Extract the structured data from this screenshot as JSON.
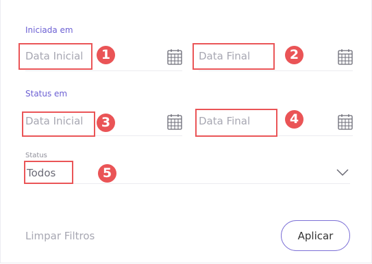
{
  "sections": {
    "started": {
      "label": "Iniciada em",
      "start_placeholder": "Data Inicial",
      "end_placeholder": "Data Final"
    },
    "status_date": {
      "label": "Status em",
      "start_placeholder": "Data Inicial",
      "end_placeholder": "Data Final"
    }
  },
  "status": {
    "label": "Status",
    "value": "Todos"
  },
  "actions": {
    "clear_label": "Limpar Filtros",
    "apply_label": "Aplicar"
  },
  "annotations": [
    "1",
    "2",
    "3",
    "4",
    "5"
  ],
  "colors": {
    "accent": "#6b5fd3",
    "highlight": "#ea5456",
    "placeholder": "#a7a7b2"
  },
  "icons": {
    "calendar": "calendar-icon",
    "chevron": "chevron-down-icon"
  }
}
